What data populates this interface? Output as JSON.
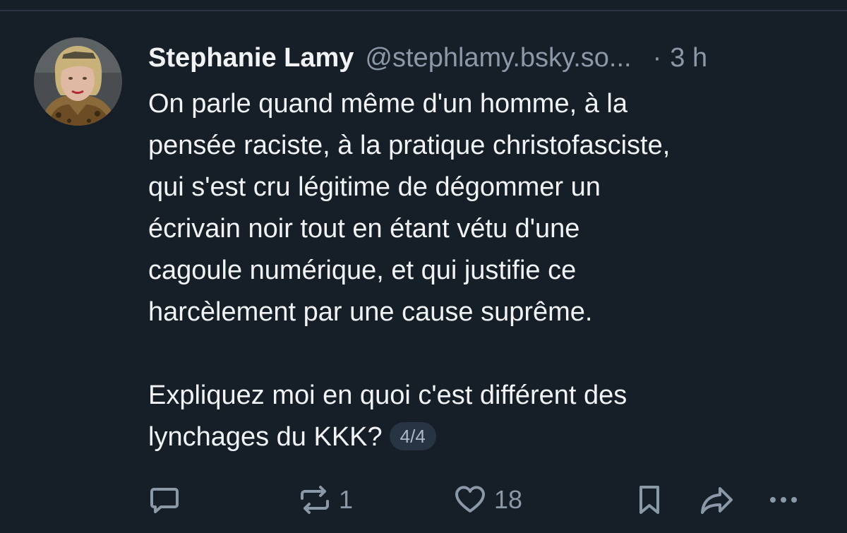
{
  "author": {
    "display_name": "Stephanie Lamy",
    "handle": "@stephlamy.bsky.so...",
    "separator": "·",
    "time": "3 h"
  },
  "post": {
    "lines": [
      "On parle quand même d'un homme, à la",
      "pensée raciste, à la pratique christofasciste,",
      "qui s'est cru légitime de dégommer un",
      "écrivain noir tout en étant vétu d'une",
      "cagoule numérique, et qui justifie ce",
      "harcèlement par une cause suprême."
    ],
    "second_paragraph": [
      "Expliquez moi en quoi c'est différent des",
      "lynchages du KKK?"
    ],
    "thread_badge": "4/4"
  },
  "actions": {
    "reply": {
      "icon": "reply-icon",
      "count": ""
    },
    "repost": {
      "icon": "repost-icon",
      "count": "1"
    },
    "like": {
      "icon": "heart-icon",
      "count": "18"
    },
    "bookmark": {
      "icon": "bookmark-icon"
    },
    "share": {
      "icon": "share-icon"
    },
    "more": {
      "icon": "more-icon"
    }
  },
  "colors": {
    "background": "#161e27",
    "text": "#f1f3f5",
    "muted": "#8b98a8",
    "badge_bg": "#283444"
  }
}
